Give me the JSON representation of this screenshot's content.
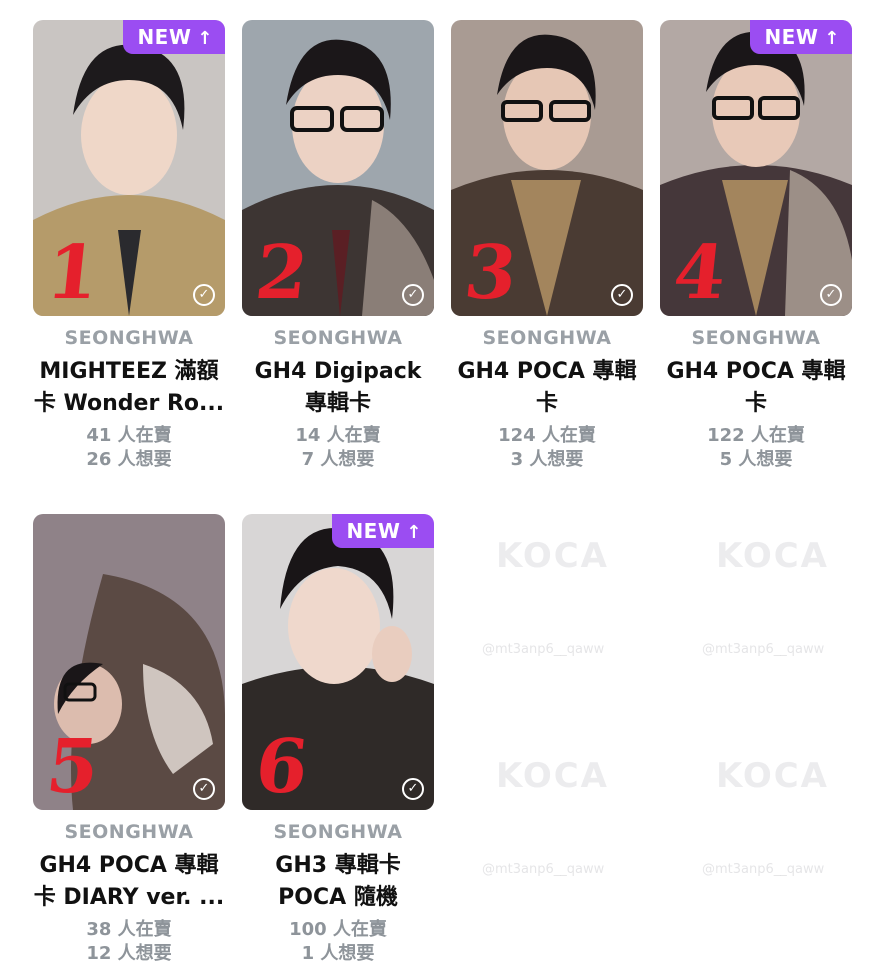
{
  "cards": [
    {
      "artist": "SEONGHWA",
      "title_line1": "MIGHTEEZ 滿額",
      "title_line2": "卡 Wonder Ro...",
      "selling": "41 人在賣",
      "wanting": "26 人想要",
      "badge": "NEW",
      "numeral": "1"
    },
    {
      "artist": "SEONGHWA",
      "title_line1": "GH4 Digipack",
      "title_line2": "專輯卡",
      "selling": "14 人在賣",
      "wanting": "7 人想要",
      "badge": "",
      "numeral": "2"
    },
    {
      "artist": "SEONGHWA",
      "title_line1": "GH4 POCA 專輯",
      "title_line2": "卡",
      "selling": "124 人在賣",
      "wanting": "3 人想要",
      "badge": "",
      "numeral": "3"
    },
    {
      "artist": "SEONGHWA",
      "title_line1": "GH4 POCA 專輯",
      "title_line2": "卡",
      "selling": "122 人在賣",
      "wanting": "5 人想要",
      "badge": "NEW",
      "numeral": "4"
    },
    {
      "artist": "SEONGHWA",
      "title_line1": "GH4 POCA 專輯",
      "title_line2": "卡 DIARY ver. ...",
      "selling": "38 人在賣",
      "wanting": "12 人想要",
      "badge": "",
      "numeral": "5"
    },
    {
      "artist": "SEONGHWA",
      "title_line1": "GH3 專輯卡",
      "title_line2": "POCA 隨機",
      "selling": "100 人在賣",
      "wanting": "1 人想要",
      "badge": "NEW",
      "numeral": "6"
    }
  ],
  "watermark": {
    "brand": "KOCA",
    "handle": "@mt3anp6__qaww"
  },
  "icons": {
    "badge_arrow": "arrow-up-icon",
    "owned": "check-circle-icon"
  },
  "colors": {
    "badge": "#9b4df2",
    "numeral": "#e5202c",
    "muted_text": "#8e949a"
  }
}
